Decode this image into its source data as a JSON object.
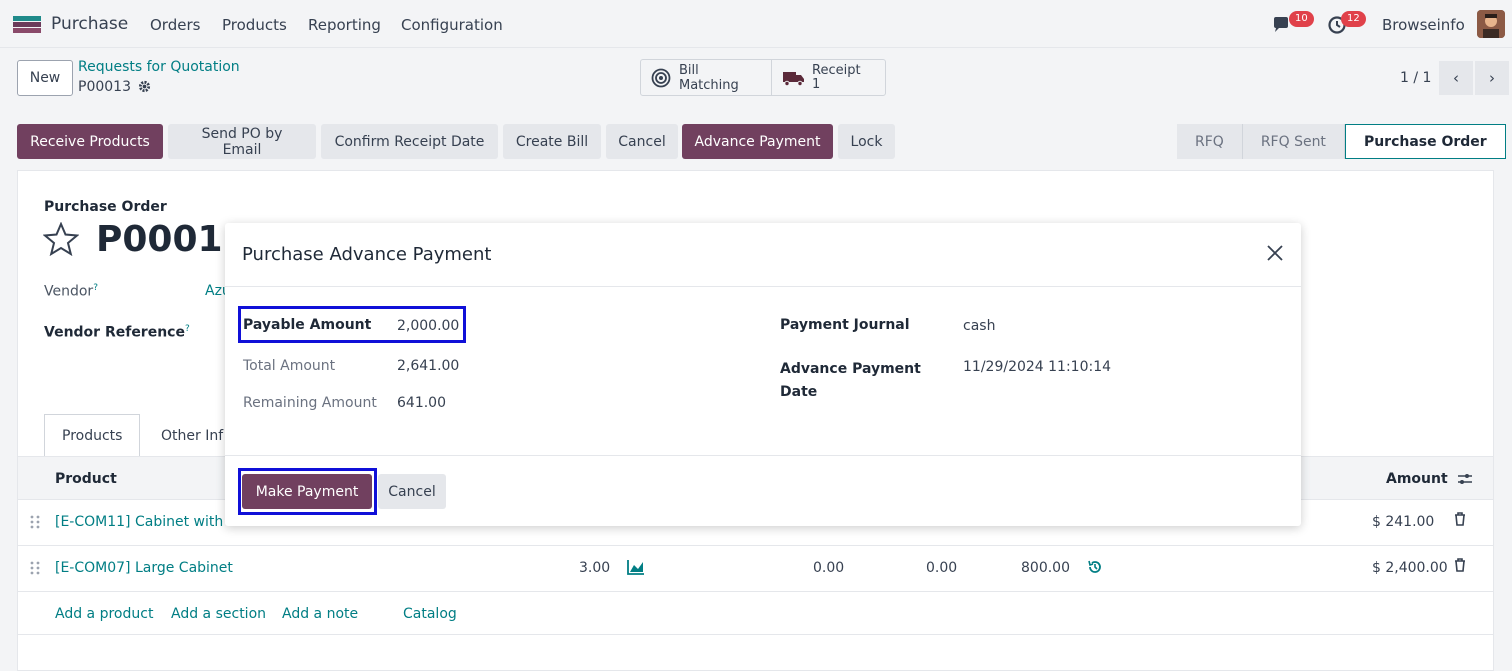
{
  "navbar": {
    "app_name": "Purchase",
    "menu": [
      "Orders",
      "Products",
      "Reporting",
      "Configuration"
    ],
    "messages_badge": "10",
    "activities_badge": "12",
    "user_name": "Browseinfo"
  },
  "control_panel": {
    "new_label": "New",
    "breadcrumb": "Requests for Quotation",
    "record_name": "P00013",
    "bill_matching_label": "Bill Matching",
    "receipt_label": "Receipt",
    "receipt_count": "1",
    "pager": "1 / 1"
  },
  "actions": {
    "buttons": [
      "Receive Products",
      "Send PO by Email",
      "Confirm Receipt Date",
      "Create Bill",
      "Cancel",
      "Advance Payment",
      "Lock"
    ],
    "status_steps": [
      "RFQ",
      "RFQ Sent",
      "Purchase Order"
    ]
  },
  "form": {
    "doc_type": "Purchase Order",
    "name": "P00013",
    "vendor_label": "Vendor",
    "vendor_value": "Azu",
    "vendor_ref_label": "Vendor Reference",
    "tabs": [
      "Products",
      "Other Inf"
    ],
    "columns": {
      "product": "Product",
      "amount": "Amount"
    },
    "rows": [
      {
        "product": "[E-COM11] Cabinet with",
        "qty": "",
        "c1": "",
        "c2": "",
        "price": "",
        "amount": "$ 241.00"
      },
      {
        "product": "[E-COM07] Large Cabinet",
        "qty": "3.00",
        "c1": "0.00",
        "c2": "0.00",
        "price": "800.00",
        "amount": "$ 2,400.00"
      }
    ],
    "add_links": [
      "Add a product",
      "Add a section",
      "Add a note",
      "Catalog"
    ]
  },
  "modal": {
    "title": "Purchase Advance Payment",
    "payable_amount_label": "Payable Amount",
    "payable_amount_value": "2,000.00",
    "total_amount_label": "Total Amount",
    "total_amount_value": "2,641.00",
    "remaining_amount_label": "Remaining Amount",
    "remaining_amount_value": "641.00",
    "payment_journal_label": "Payment Journal",
    "payment_journal_value": "cash",
    "advance_date_label_1": "Advance Payment",
    "advance_date_label_2": "Date",
    "advance_date_value": "11/29/2024 11:10:14",
    "make_payment_label": "Make Payment",
    "cancel_label": "Cancel"
  },
  "colors": {
    "primary": "#71405f",
    "link": "#017e84",
    "highlight": "#1010d8",
    "badge": "#e0414a"
  }
}
